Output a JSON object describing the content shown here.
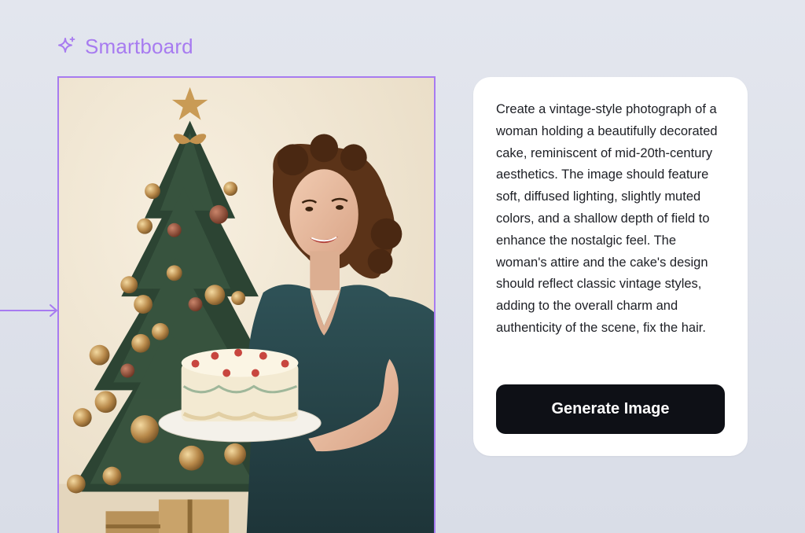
{
  "header": {
    "title": "Smartboard",
    "icon": "sparkle-icon",
    "accent_color": "#a77bf0"
  },
  "canvas": {
    "connector_icon": "arrow-right-icon"
  },
  "prompt_card": {
    "prompt_text": "Create a vintage-style photograph of a woman holding a beautifully decorated cake, reminiscent of mid-20th-century aesthetics. The image should feature soft, diffused lighting, slightly muted colors, and a shallow depth of field to enhance the nostalgic feel. The woman's attire and the cake's design should reflect classic vintage styles, adding to the overall charm and authenticity of the scene, fix the hair.",
    "generate_button_label": "Generate Image",
    "button_color": "#0e1016"
  }
}
